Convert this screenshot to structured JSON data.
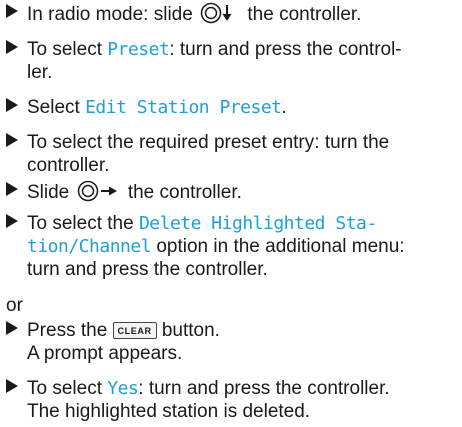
{
  "icons": {
    "bullet": "right-triangle-icon",
    "controller": "controller-slide-icon",
    "accent": "#1e9fd6"
  },
  "steps": [
    {
      "pre": "In radio mode: slide",
      "post": "the controller."
    },
    {
      "pre": "To select ",
      "hl": "Preset",
      "post": ": turn and press the control-",
      "line2": "ler."
    },
    {
      "pre": "Select ",
      "hl": "Edit Station Preset",
      "post": "."
    },
    {
      "line1": "To select the required preset entry: turn the",
      "line2": "controller."
    },
    {
      "pre": "Slide",
      "post": "the controller."
    },
    {
      "pre": "To select the ",
      "hl1": "Delete Highlighted Sta-",
      "hl2": "tion/Channel",
      "post2": " option in the additional menu:",
      "line3": "turn and press the controller."
    },
    {
      "pre": "Press the",
      "button": "CLEAR",
      "post": "button.",
      "line2": "A prompt appears."
    },
    {
      "pre": "To select ",
      "hl": "Yes",
      "post": ": turn and press the controller.",
      "line2": "The highlighted station is deleted."
    }
  ],
  "or": "or"
}
